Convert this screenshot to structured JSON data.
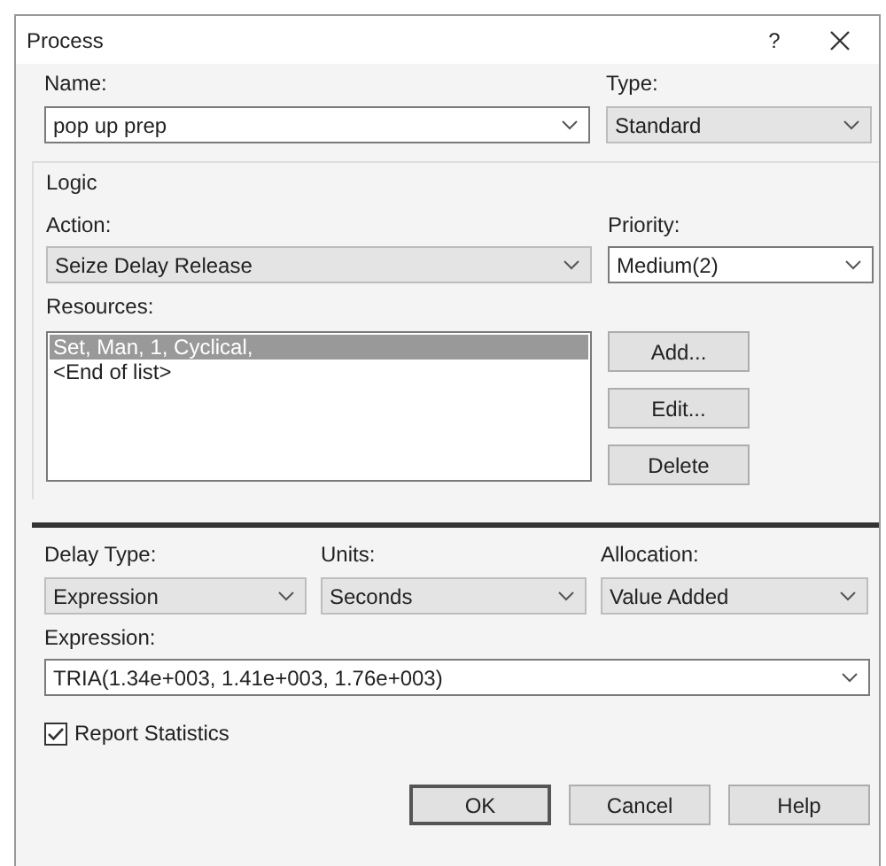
{
  "window": {
    "title": "Process",
    "help": "?"
  },
  "name": {
    "label": "Name:",
    "value": "pop up prep",
    "kind": "edit"
  },
  "type": {
    "label": "Type:",
    "value": "Standard",
    "kind": "list"
  },
  "logic": {
    "title": "Logic",
    "action": {
      "label": "Action:",
      "value": "Seize Delay Release",
      "kind": "list"
    },
    "priority": {
      "label": "Priority:",
      "value": "Medium(2)",
      "kind": "edit"
    },
    "resources": {
      "label": "Resources:",
      "items": [
        {
          "text": "Set, Man, 1, Cyclical,",
          "selected": true
        },
        {
          "text": "<End of list>",
          "selected": false
        }
      ]
    },
    "buttons": [
      "Add...",
      "Edit...",
      "Delete"
    ]
  },
  "delay": [
    {
      "label": "Delay Type:",
      "value": "Expression",
      "kind": "list"
    },
    {
      "label": "Units:",
      "value": "Seconds",
      "kind": "list"
    },
    {
      "label": "Allocation:",
      "value": "Value Added",
      "kind": "list"
    }
  ],
  "expression": {
    "label": "Expression:",
    "value": "TRIA(1.34e+003, 1.41e+003, 1.76e+003)",
    "kind": "edit"
  },
  "report_statistics": {
    "label": "Report Statistics",
    "checked": true
  },
  "buttons": [
    {
      "label": "OK",
      "default": true
    },
    {
      "label": "Cancel",
      "default": false
    },
    {
      "label": "Help",
      "default": false
    }
  ]
}
